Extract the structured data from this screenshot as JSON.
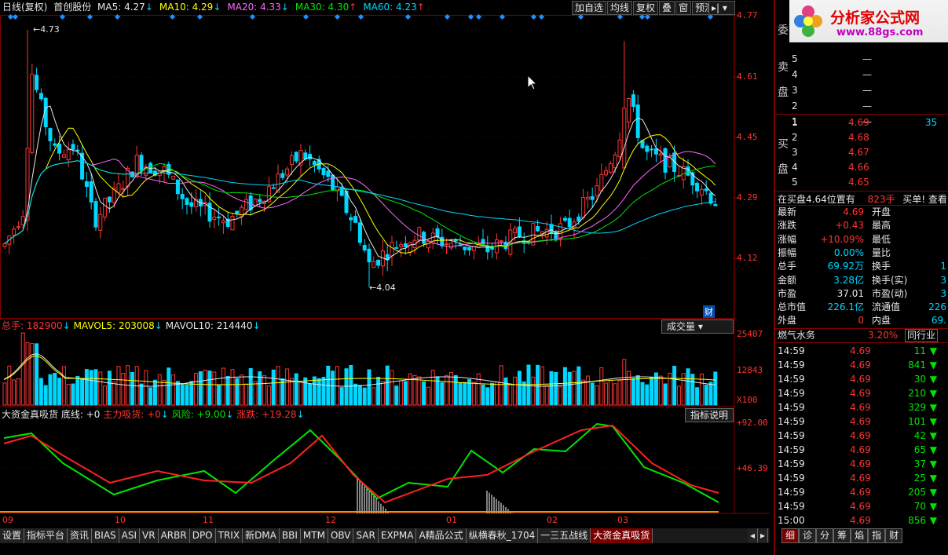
{
  "header": {
    "period": "日线(复权)",
    "stock": "首创股份",
    "ma": [
      {
        "label": "MA5: 4.27",
        "arrow": "↓",
        "color": "#e6e6e6"
      },
      {
        "label": "MA10: 4.29",
        "arrow": "↓",
        "color": "#ffff00"
      },
      {
        "label": "MA20: 4.33",
        "arrow": "↓",
        "color": "#ff66ff"
      },
      {
        "label": "MA30: 4.30",
        "arrow": "↑",
        "color": "#00e600"
      },
      {
        "label": "MA60: 4.23",
        "arrow": "↑",
        "color": "#00d7ff"
      }
    ],
    "buttons": [
      "加自选",
      "均线",
      "复权",
      "叠",
      "窗",
      "预测"
    ]
  },
  "price_axis": [
    "4.77",
    "4.61",
    "4.45",
    "4.29",
    "4.12"
  ],
  "annotations": {
    "high": "4.73",
    "low": "4.04",
    "cai": "财"
  },
  "volume": {
    "title": "总手: 182900",
    "mavol5": "MAVOL5: 203008",
    "mavol10": "MAVOL10: 214440",
    "btn": "成交量",
    "axis": [
      "25407",
      "12843",
      "X100"
    ]
  },
  "indicator": {
    "name": "大资金真吸货",
    "base": "底线: +0",
    "main": "主力吸货: +0",
    "risk": "风险: +9.00",
    "change": "涨跌: +19.28",
    "btn": "指标说明",
    "axis": [
      "+92.00",
      "+46.39"
    ]
  },
  "months": [
    "09",
    "10",
    "11",
    "12",
    "01",
    "02",
    "03"
  ],
  "tabs": [
    "设置",
    "指标平台",
    "资讯",
    "BIAS",
    "ASI",
    "VR",
    "ARBR",
    "DPO",
    "TRIX",
    "新DMA",
    "BBI",
    "MTM",
    "OBV",
    "SAR",
    "EXPMA",
    "A精品公式",
    "纵横春秋_1704",
    "一三五战线",
    "大资金真吸货"
  ],
  "logo": {
    "text": "分析家公式网",
    "url": "www.88gs.com"
  },
  "orderbook": {
    "wei": "委",
    "sell_label": "卖盘",
    "buy_label": "买盘",
    "sells": [
      [
        "5",
        "—"
      ],
      [
        "4",
        "—"
      ],
      [
        "3",
        "—"
      ],
      [
        "2",
        "—"
      ],
      [
        "1",
        "—"
      ]
    ],
    "buys": [
      [
        "1",
        "4.69",
        "35"
      ],
      [
        "2",
        "4.68",
        ""
      ],
      [
        "3",
        "4.67",
        ""
      ],
      [
        "4",
        "4.66",
        ""
      ],
      [
        "5",
        "4.65",
        ""
      ]
    ],
    "status": {
      "left": "在买盘4.64位置有",
      "mid": "823手",
      "right": "买单! 查看"
    }
  },
  "quote": [
    {
      "k": "最新",
      "v": "4.69",
      "vc": "#ff3333",
      "k2": "开盘",
      "v2": ""
    },
    {
      "k": "涨跌",
      "v": "+0.43",
      "vc": "#ff3333",
      "k2": "最高",
      "v2": ""
    },
    {
      "k": "涨幅",
      "v": "+10.09%",
      "vc": "#ff3333",
      "k2": "最低",
      "v2": ""
    },
    {
      "k": "振幅",
      "v": "0.00%",
      "vc": "#00d7ff",
      "k2": "量比",
      "v2": ""
    },
    {
      "k": "总手",
      "v": "69.92万",
      "vc": "#00d7ff",
      "k2": "换手",
      "v2": "1"
    },
    {
      "k": "金额",
      "v": "3.28亿",
      "vc": "#00d7ff",
      "k2": "换手(实)",
      "v2": "3"
    },
    {
      "k": "市盈",
      "v": "37.01",
      "vc": "#e6e6e6",
      "k2": "市盈(动)",
      "v2": "3"
    },
    {
      "k": "总市值",
      "v": "226.1亿",
      "vc": "#00d7ff",
      "k2": "流通值",
      "v2": "226"
    },
    {
      "k": "外盘",
      "v": "0",
      "vc": "#ff3333",
      "k2": "内盘",
      "v2": "69."
    }
  ],
  "sector": {
    "name": "燃气水务",
    "pct": "3.20%",
    "btn": "同行业"
  },
  "ticks": [
    [
      "14:59",
      "4.69",
      "11"
    ],
    [
      "14:59",
      "4.69",
      "841"
    ],
    [
      "14:59",
      "4.69",
      "30"
    ],
    [
      "14:59",
      "4.69",
      "210"
    ],
    [
      "14:59",
      "4.69",
      "329"
    ],
    [
      "14:59",
      "4.69",
      "101"
    ],
    [
      "14:59",
      "4.69",
      "42"
    ],
    [
      "14:59",
      "4.69",
      "65"
    ],
    [
      "14:59",
      "4.69",
      "37"
    ],
    [
      "14:59",
      "4.69",
      "25"
    ],
    [
      "14:59",
      "4.69",
      "205"
    ],
    [
      "14:59",
      "4.69",
      "70"
    ],
    [
      "15:00",
      "4.69",
      "856"
    ]
  ],
  "rtabs": [
    "细",
    "诊",
    "分",
    "筹",
    "焰",
    "指",
    "财"
  ],
  "colors": {
    "up": "#ff3333",
    "down": "#00d7ff",
    "grid": "#800000",
    "green": "#00e600"
  }
}
